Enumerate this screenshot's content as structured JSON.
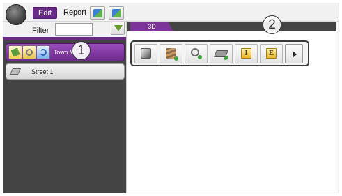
{
  "ribbon": {
    "tabs": [
      {
        "label": "Edit",
        "active": true
      },
      {
        "label": "Report",
        "active": false
      }
    ],
    "quick_buttons": [
      {
        "icon": "map-layers-icon"
      },
      {
        "icon": "map-export-icon"
      }
    ]
  },
  "filter": {
    "label": "Filter",
    "value": "",
    "button_icon": "filter-funnel-icon"
  },
  "left_panel": {
    "layer_label": "Town Model",
    "layer_buttons": [
      {
        "icon": "edit-pencil-icon"
      },
      {
        "icon": "zoom-magnifier-icon"
      },
      {
        "icon": "refresh-icon"
      }
    ],
    "items": [
      {
        "label": "Street 1",
        "icon": "street-plane-icon"
      }
    ]
  },
  "view": {
    "tab_label": "3D",
    "toolbar_buttons": [
      {
        "icon": "cube-icon",
        "glyph": ""
      },
      {
        "icon": "add-layers-icon",
        "glyph": ""
      },
      {
        "icon": "zoom-add-icon",
        "glyph": ""
      },
      {
        "icon": "add-plane-icon",
        "glyph": ""
      },
      {
        "icon": "import-icon",
        "glyph": "I"
      },
      {
        "icon": "export-icon",
        "glyph": "E"
      }
    ],
    "more_icon": "chevron-right-icon"
  },
  "callouts": [
    "1",
    "2"
  ],
  "colors": {
    "accent_purple": "#6a2a88",
    "panel_dark": "#444444",
    "toolbar_border": "#3a3a3a"
  }
}
